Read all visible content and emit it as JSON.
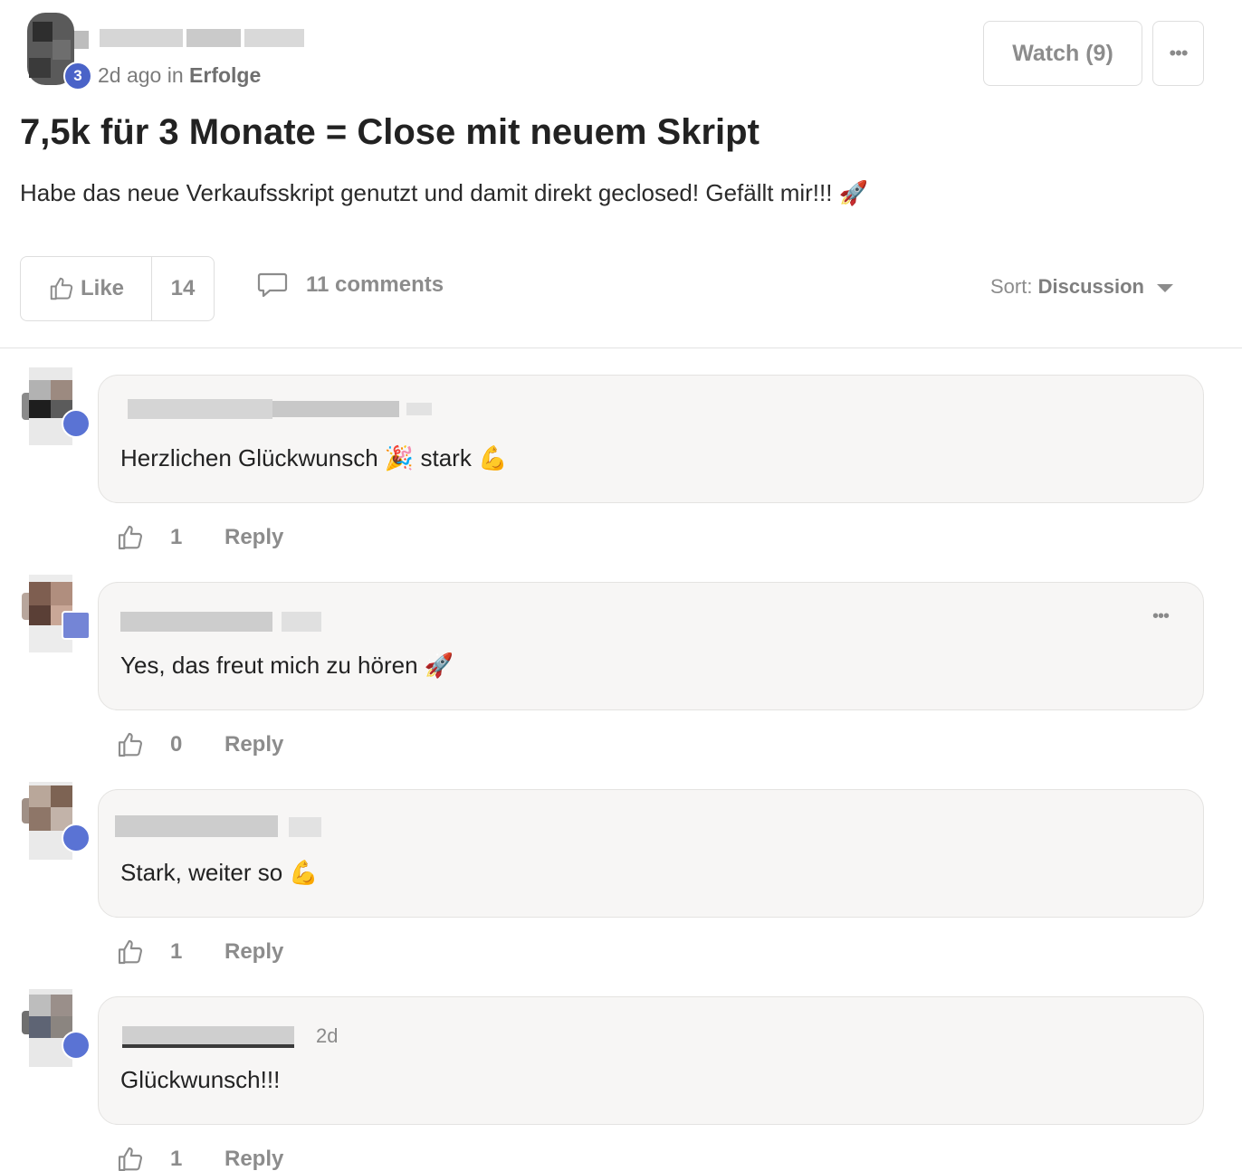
{
  "post": {
    "level": "3",
    "time": "2d ago",
    "in_label": "in",
    "category": "Erfolge",
    "title": "7,5k für 3 Monate = Close mit neuem Skript",
    "body": "Habe das neue Verkaufsskript genutzt und damit direkt geclosed! Gefällt mir!!! 🚀",
    "watch_label": "Watch (9)",
    "more_label": "•••",
    "like_label": "Like",
    "like_count": "14",
    "comments_label": "11 comments",
    "sort_prefix": "Sort:",
    "sort_value": "Discussion"
  },
  "comments": [
    {
      "text": "Herzlichen Glückwunsch 🎉 stark 💪",
      "likes": "1",
      "reply": "Reply",
      "time": ""
    },
    {
      "text": "Yes, das freut mich zu hören 🚀",
      "likes": "0",
      "reply": "Reply",
      "time": "",
      "menu": "•••"
    },
    {
      "text": "Stark, weiter so 💪",
      "likes": "1",
      "reply": "Reply",
      "time": ""
    },
    {
      "text": "Glückwunsch!!!",
      "likes": "1",
      "reply": "Reply",
      "time": "2d"
    }
  ],
  "colors": {
    "accent": "#4a63c8",
    "bubble": "#f7f6f5",
    "muted": "#8c8c8c"
  },
  "icons": [
    "thumbs-up-icon",
    "comment-icon",
    "caret-down-icon",
    "more-icon"
  ]
}
